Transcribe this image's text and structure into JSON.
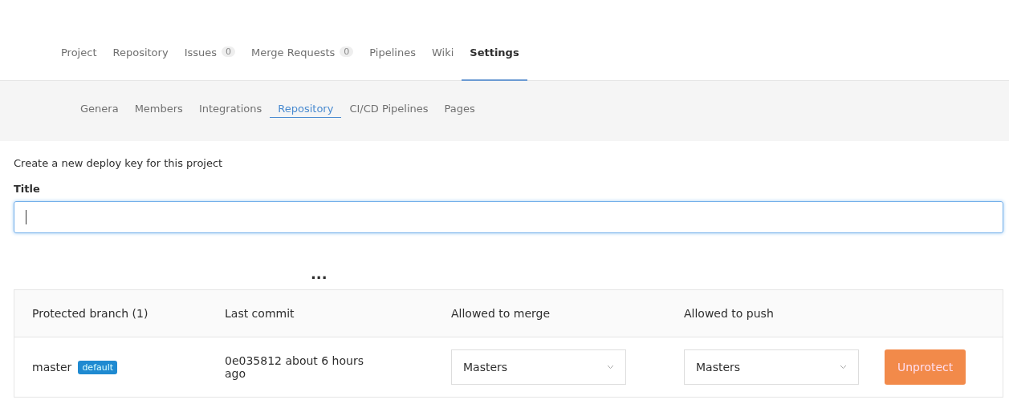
{
  "nav_tabs": [
    {
      "label": "Project",
      "selected": false
    },
    {
      "label": "Repository",
      "selected": false
    },
    {
      "label": "Issues",
      "count": "0",
      "selected": false
    },
    {
      "label": "Merge Requests",
      "count": "0",
      "selected": false
    },
    {
      "label": "Pipelines",
      "selected": false
    },
    {
      "label": "Wiki",
      "selected": false
    },
    {
      "label": "Settings",
      "selected": true
    }
  ],
  "sub_tabs": [
    {
      "label": "Genera",
      "selected": false
    },
    {
      "label": "Members",
      "selected": false
    },
    {
      "label": "Integrations",
      "selected": false
    },
    {
      "label": "Repository",
      "selected": true
    },
    {
      "label": "CI/CD Pipelines",
      "selected": false
    },
    {
      "label": "Pages",
      "selected": false
    }
  ],
  "deploy_key": {
    "heading": "Create a new deploy key for this project",
    "title_label": "Title",
    "focused": true
  },
  "ellipsis": "...",
  "table": {
    "columns": [
      "Protected branch (1)",
      "Last commit",
      "Allowed to merge",
      "Allowed to push"
    ],
    "rows": [
      {
        "branch": "master",
        "badge": "default",
        "commit": "0e035812 about 6 hours ago",
        "merge": "Masters",
        "push": "Masters",
        "action": "Unprotect"
      }
    ]
  }
}
